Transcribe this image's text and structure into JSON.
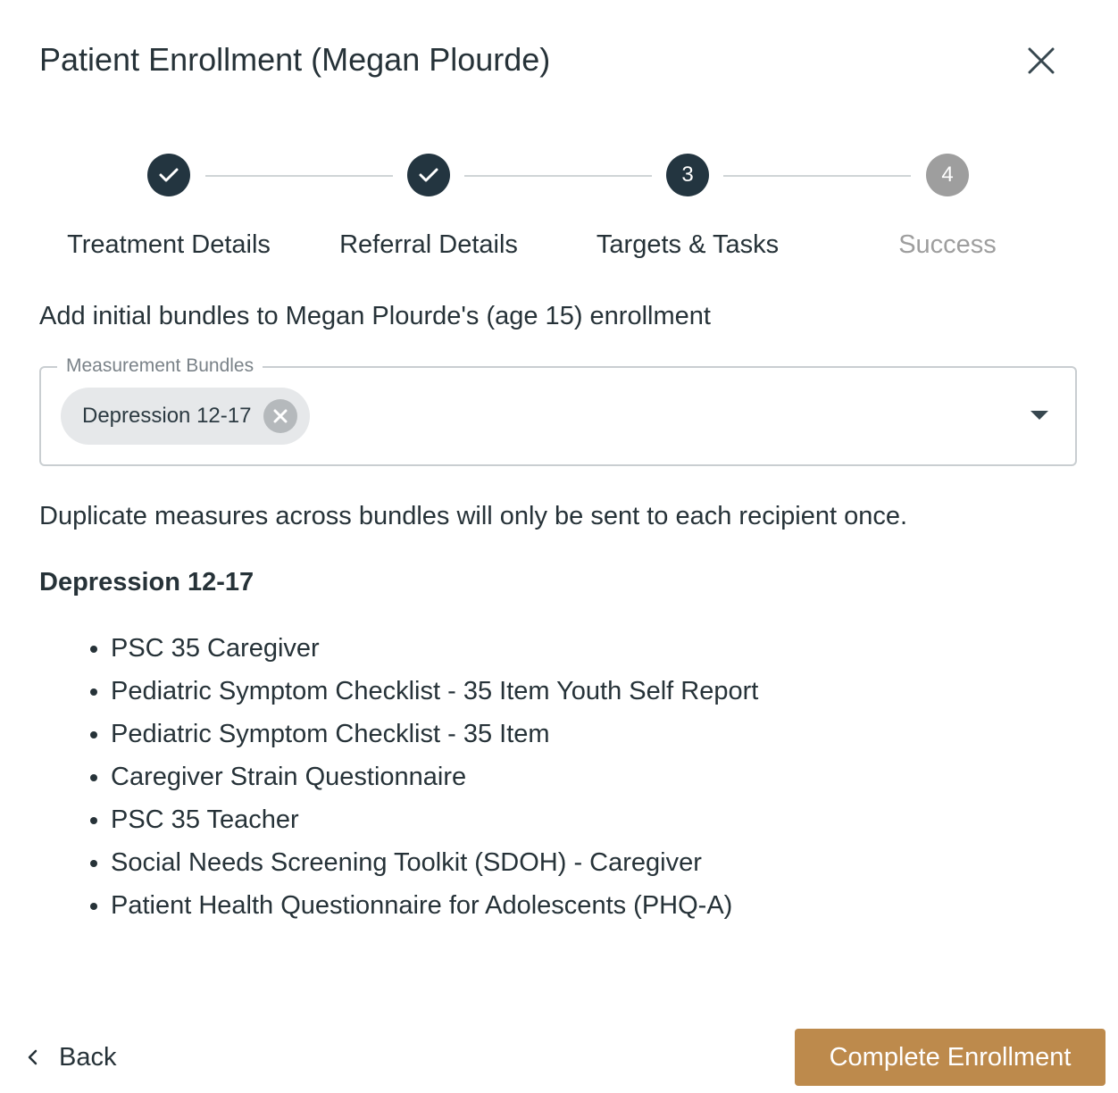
{
  "dialog": {
    "title": "Patient Enrollment (Megan Plourde)",
    "close_icon": "close-icon"
  },
  "stepper": {
    "steps": [
      {
        "label": "Treatment Details",
        "state": "completed",
        "icon": "check-icon",
        "number": "1"
      },
      {
        "label": "Referral Details",
        "state": "completed",
        "icon": "check-icon",
        "number": "2"
      },
      {
        "label": "Targets & Tasks",
        "state": "active",
        "number": "3"
      },
      {
        "label": "Success",
        "state": "pending",
        "number": "4"
      }
    ]
  },
  "intro_text": "Add initial bundles to Megan Plourde's (age 15) enrollment",
  "bundle_select": {
    "label": "Measurement Bundles",
    "selected": [
      "Depression 12-17"
    ],
    "dropdown_icon": "caret-down-icon",
    "remove_icon": "cancel-circle-icon"
  },
  "duplicate_note": "Duplicate measures across bundles will only be sent to each recipient once.",
  "bundle": {
    "name": "Depression 12-17",
    "measures": [
      "PSC 35 Caregiver",
      "Pediatric Symptom Checklist - 35 Item Youth Self Report",
      "Pediatric Symptom Checklist - 35 Item",
      "Caregiver Strain Questionnaire",
      "PSC 35 Teacher",
      "Social Needs Screening Toolkit (SDOH) - Caregiver",
      "Patient Health Questionnaire for Adolescents (PHQ-A)"
    ]
  },
  "footer": {
    "back_label": "Back",
    "back_icon": "chevron-left-icon",
    "complete_label": "Complete Enrollment"
  },
  "colors": {
    "primary_dark": "#233540",
    "accent": "#bd8a4c",
    "pending": "#9e9e9e"
  }
}
